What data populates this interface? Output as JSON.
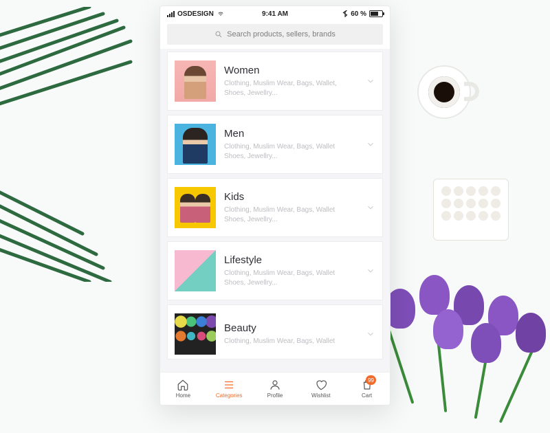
{
  "status": {
    "carrier": "OSDESIGN",
    "time": "9:41 AM",
    "battery": "60 %"
  },
  "search": {
    "placeholder": "Search products, sellers, brands"
  },
  "categories": [
    {
      "title": "Women",
      "sub": "Clothing, Muslim Wear, Bags, Wallet, Shoes, Jewellry..."
    },
    {
      "title": "Men",
      "sub": "Clothing, Muslim Wear, Bags, Wallet Shoes, Jewellry..."
    },
    {
      "title": "Kids",
      "sub": "Clothing, Muslim Wear, Bags, Wallet Shoes, Jewellry..."
    },
    {
      "title": "Lifestyle",
      "sub": "Clothing, Muslim Wear, Bags, Wallet Shoes, Jewellry..."
    },
    {
      "title": "Beauty",
      "sub": "Clothing, Muslim Wear, Bags, Wallet"
    }
  ],
  "tabs": {
    "home": "Home",
    "categories": "Categories",
    "profile": "Profile",
    "wishlist": "Wishlist",
    "cart": "Cart",
    "cart_badge": "99"
  }
}
